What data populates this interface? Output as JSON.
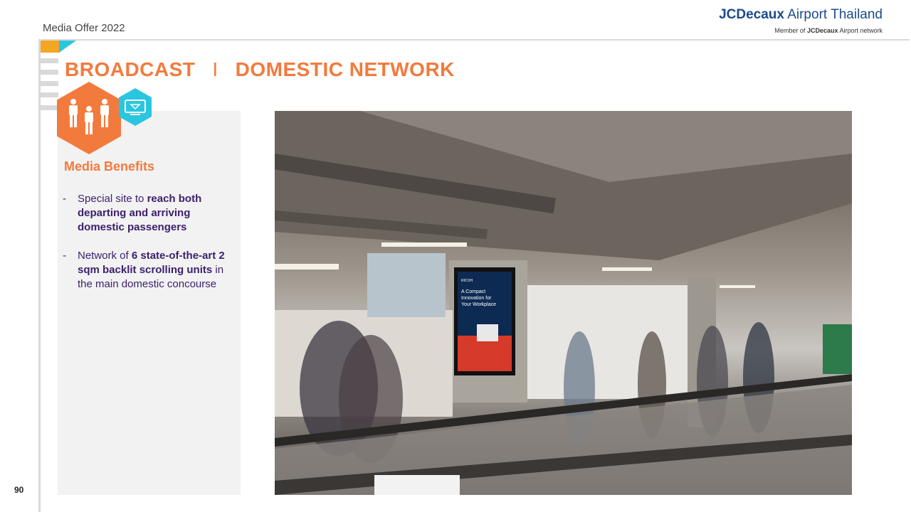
{
  "header": {
    "media_offer": "Media Offer 2022",
    "brand_bold": "JCDecaux",
    "brand_rest": " Airport Thailand",
    "brand_sub_pre": "Member of ",
    "brand_sub_bold": "JCDecaux",
    "brand_sub_post": " Airport network"
  },
  "title": {
    "left": "BROADCAST",
    "separator": "I",
    "right": "DOMESTIC NETWORK"
  },
  "icons": {
    "primary": "people-icon",
    "secondary": "display-screen-icon"
  },
  "benefits": {
    "heading": "Media Benefits",
    "bullet_1": {
      "dash": "-",
      "plain_1": "Special site to ",
      "bold_1": "reach both departing and arriving domestic passengers"
    },
    "bullet_2": {
      "dash": "-",
      "plain_1": "Network of ",
      "bold_1": "6 state-of-the-art 2 sqm backlit scrolling units",
      "plain_2": " in the main domestic concourse"
    }
  },
  "photo": {
    "ad_title": "A Compact Innovation for Your Workplace",
    "ad_brand": "RICOH"
  },
  "footer": {
    "page_number": "90"
  },
  "colors": {
    "orange": "#f37a3d",
    "teal": "#29c6e0",
    "yellow": "#f5a623",
    "purple": "#3c1f6b",
    "brand_blue": "#1a4a8c"
  }
}
